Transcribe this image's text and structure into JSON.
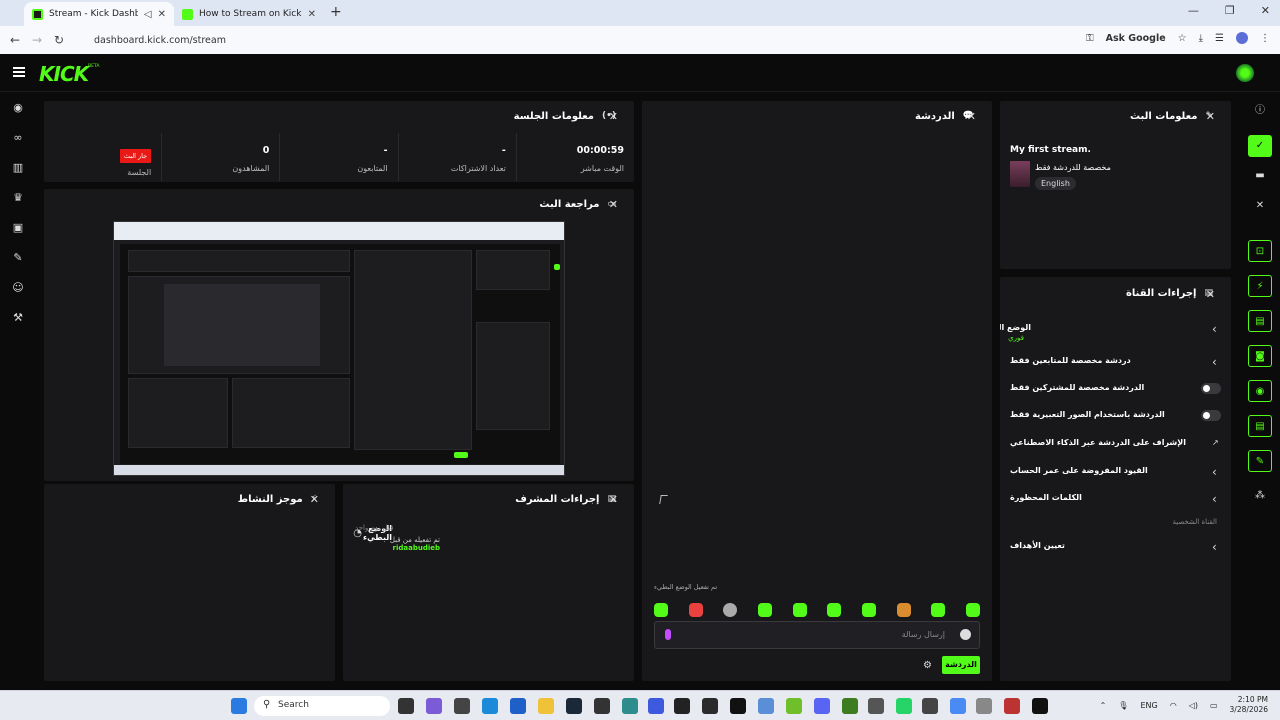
{
  "browser": {
    "tabs": [
      {
        "title": "Stream - Kick Dashboard",
        "active": true
      },
      {
        "title": "How to Stream on Kick.com | Ki",
        "active": false
      }
    ],
    "url": "dashboard.kick.com/stream",
    "ask_google": "Ask Google"
  },
  "header": {
    "logo": "KICK",
    "beta": "BETA"
  },
  "session_info": {
    "title": "معلومات الجلسة",
    "stats": [
      {
        "label": "الوقت مباشر",
        "value": "00:00:59"
      },
      {
        "label": "تعداد الاشتراكات",
        "value": "-"
      },
      {
        "label": "المتابعون",
        "value": "-"
      },
      {
        "label": "المشاهدون",
        "value": "0"
      },
      {
        "label": "الجلسة",
        "badge": "جار البث"
      }
    ]
  },
  "stream_preview": {
    "title": "مراجعة البث"
  },
  "activity_feed": {
    "title": "موجز النشاط"
  },
  "mod_actions": {
    "title": "إجراءات المشرف",
    "items": [
      {
        "title": "الوضع البطيء",
        "sub_prefix": "تم تفعيله من قبل",
        "user": "ridaabudieb",
        "time": "قبل يوم واحد"
      }
    ]
  },
  "chat": {
    "title": "الدردشة",
    "notice": "تم تفعيل الوضع البطيء",
    "input_placeholder": "إرسال رسالة",
    "send_label": "الدردشة"
  },
  "stream_info": {
    "title": "معلومات البث",
    "stream_title": "My first stream.",
    "category": "مخصصة للدردشة فقط",
    "tag": "English"
  },
  "channel_actions": {
    "title": "إجراءات القناة",
    "rows": [
      {
        "label": "الوضع البطيء",
        "sub": "فوري",
        "control": "chevron"
      },
      {
        "label": "دردشة مخصصة للمتابعين فقط",
        "control": "chevron"
      },
      {
        "label": "الدردشة مخصصة للمشتركين فقط",
        "control": "toggle"
      },
      {
        "label": "الدردشة باستخدام الصور التعبيرية فقط",
        "control": "toggle"
      },
      {
        "label": "الإشراف على الدردشة عبر الذكاء الاصطناعي",
        "control": "external"
      },
      {
        "label": "القيود المفروضة على عمر الحساب",
        "control": "chevron"
      },
      {
        "label": "الكلمات المحظورة",
        "control": "chevron"
      }
    ],
    "section_label": "القناة الشخصية",
    "goals_label": "تعيين الأهداف"
  },
  "taskbar": {
    "search": "Search",
    "lang": "ENG",
    "time": "2:10 PM",
    "date": "3/28/2026"
  },
  "colors": {
    "accent": "#53fc18",
    "live": "#e91916",
    "panel": "#18181b",
    "bg": "#0b0b0c"
  }
}
